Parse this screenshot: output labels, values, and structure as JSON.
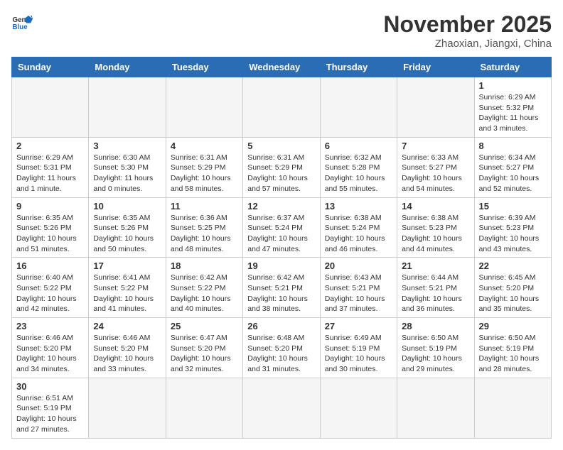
{
  "header": {
    "logo_general": "General",
    "logo_blue": "Blue",
    "month": "November 2025",
    "location": "Zhaoxian, Jiangxi, China"
  },
  "weekdays": [
    "Sunday",
    "Monday",
    "Tuesday",
    "Wednesday",
    "Thursday",
    "Friday",
    "Saturday"
  ],
  "weeks": [
    [
      {
        "day": "",
        "info": ""
      },
      {
        "day": "",
        "info": ""
      },
      {
        "day": "",
        "info": ""
      },
      {
        "day": "",
        "info": ""
      },
      {
        "day": "",
        "info": ""
      },
      {
        "day": "",
        "info": ""
      },
      {
        "day": "1",
        "info": "Sunrise: 6:29 AM\nSunset: 5:32 PM\nDaylight: 11 hours and 3 minutes."
      }
    ],
    [
      {
        "day": "2",
        "info": "Sunrise: 6:29 AM\nSunset: 5:31 PM\nDaylight: 11 hours and 1 minute."
      },
      {
        "day": "3",
        "info": "Sunrise: 6:30 AM\nSunset: 5:30 PM\nDaylight: 11 hours and 0 minutes."
      },
      {
        "day": "4",
        "info": "Sunrise: 6:31 AM\nSunset: 5:29 PM\nDaylight: 10 hours and 58 minutes."
      },
      {
        "day": "5",
        "info": "Sunrise: 6:31 AM\nSunset: 5:29 PM\nDaylight: 10 hours and 57 minutes."
      },
      {
        "day": "6",
        "info": "Sunrise: 6:32 AM\nSunset: 5:28 PM\nDaylight: 10 hours and 55 minutes."
      },
      {
        "day": "7",
        "info": "Sunrise: 6:33 AM\nSunset: 5:27 PM\nDaylight: 10 hours and 54 minutes."
      },
      {
        "day": "8",
        "info": "Sunrise: 6:34 AM\nSunset: 5:27 PM\nDaylight: 10 hours and 52 minutes."
      }
    ],
    [
      {
        "day": "9",
        "info": "Sunrise: 6:35 AM\nSunset: 5:26 PM\nDaylight: 10 hours and 51 minutes."
      },
      {
        "day": "10",
        "info": "Sunrise: 6:35 AM\nSunset: 5:26 PM\nDaylight: 10 hours and 50 minutes."
      },
      {
        "day": "11",
        "info": "Sunrise: 6:36 AM\nSunset: 5:25 PM\nDaylight: 10 hours and 48 minutes."
      },
      {
        "day": "12",
        "info": "Sunrise: 6:37 AM\nSunset: 5:24 PM\nDaylight: 10 hours and 47 minutes."
      },
      {
        "day": "13",
        "info": "Sunrise: 6:38 AM\nSunset: 5:24 PM\nDaylight: 10 hours and 46 minutes."
      },
      {
        "day": "14",
        "info": "Sunrise: 6:38 AM\nSunset: 5:23 PM\nDaylight: 10 hours and 44 minutes."
      },
      {
        "day": "15",
        "info": "Sunrise: 6:39 AM\nSunset: 5:23 PM\nDaylight: 10 hours and 43 minutes."
      }
    ],
    [
      {
        "day": "16",
        "info": "Sunrise: 6:40 AM\nSunset: 5:22 PM\nDaylight: 10 hours and 42 minutes."
      },
      {
        "day": "17",
        "info": "Sunrise: 6:41 AM\nSunset: 5:22 PM\nDaylight: 10 hours and 41 minutes."
      },
      {
        "day": "18",
        "info": "Sunrise: 6:42 AM\nSunset: 5:22 PM\nDaylight: 10 hours and 40 minutes."
      },
      {
        "day": "19",
        "info": "Sunrise: 6:42 AM\nSunset: 5:21 PM\nDaylight: 10 hours and 38 minutes."
      },
      {
        "day": "20",
        "info": "Sunrise: 6:43 AM\nSunset: 5:21 PM\nDaylight: 10 hours and 37 minutes."
      },
      {
        "day": "21",
        "info": "Sunrise: 6:44 AM\nSunset: 5:21 PM\nDaylight: 10 hours and 36 minutes."
      },
      {
        "day": "22",
        "info": "Sunrise: 6:45 AM\nSunset: 5:20 PM\nDaylight: 10 hours and 35 minutes."
      }
    ],
    [
      {
        "day": "23",
        "info": "Sunrise: 6:46 AM\nSunset: 5:20 PM\nDaylight: 10 hours and 34 minutes."
      },
      {
        "day": "24",
        "info": "Sunrise: 6:46 AM\nSunset: 5:20 PM\nDaylight: 10 hours and 33 minutes."
      },
      {
        "day": "25",
        "info": "Sunrise: 6:47 AM\nSunset: 5:20 PM\nDaylight: 10 hours and 32 minutes."
      },
      {
        "day": "26",
        "info": "Sunrise: 6:48 AM\nSunset: 5:20 PM\nDaylight: 10 hours and 31 minutes."
      },
      {
        "day": "27",
        "info": "Sunrise: 6:49 AM\nSunset: 5:19 PM\nDaylight: 10 hours and 30 minutes."
      },
      {
        "day": "28",
        "info": "Sunrise: 6:50 AM\nSunset: 5:19 PM\nDaylight: 10 hours and 29 minutes."
      },
      {
        "day": "29",
        "info": "Sunrise: 6:50 AM\nSunset: 5:19 PM\nDaylight: 10 hours and 28 minutes."
      }
    ],
    [
      {
        "day": "30",
        "info": "Sunrise: 6:51 AM\nSunset: 5:19 PM\nDaylight: 10 hours and 27 minutes."
      },
      {
        "day": "",
        "info": ""
      },
      {
        "day": "",
        "info": ""
      },
      {
        "day": "",
        "info": ""
      },
      {
        "day": "",
        "info": ""
      },
      {
        "day": "",
        "info": ""
      },
      {
        "day": "",
        "info": ""
      }
    ]
  ]
}
